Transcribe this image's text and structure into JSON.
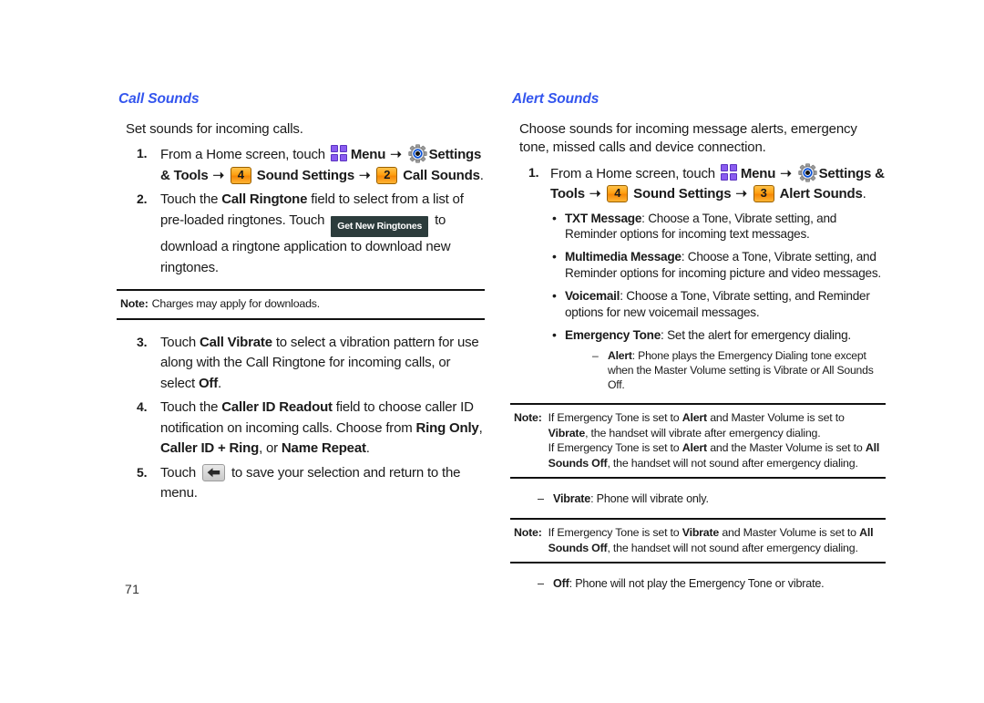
{
  "page": {
    "number": "71"
  },
  "left_column": {
    "heading": "Call Sounds",
    "intro": "Set sounds for incoming calls.",
    "steps": [
      {
        "num": "1.",
        "pre": "From a Home screen, touch",
        "menu_label": "Menu",
        "settings_label": "Settings &",
        "tools_label": "Tools",
        "badge1": "4",
        "badge1_label": "Sound Settings",
        "badge2": "2",
        "badge2_label": "Call Sounds",
        "period": "."
      },
      {
        "num": "2.",
        "t1": "Touch the ",
        "b1": "Call Ringtone",
        "t2": " field to select from a list of pre-loaded ringtones. Touch ",
        "button": "Get New Ringtones",
        "t3": " to download a ringtone application to download new ringtones."
      },
      {
        "num": "3.",
        "t1": "Touch ",
        "b1": "Call Vibrate",
        "t2": " to select a vibration pattern for use along with the Call Ringtone for incoming calls, or select ",
        "b2": "Off",
        "t3": "."
      },
      {
        "num": "4.",
        "t1": "Touch the ",
        "b1": "Caller ID Readout",
        "t2": " field to choose caller ID notification on incoming calls.  Choose from ",
        "b2": "Ring Only",
        "t3": ", ",
        "b3": "Caller ID + Ring",
        "t4": ", or ",
        "b4": "Name Repeat",
        "t5": "."
      },
      {
        "num": "5.",
        "t1": "Touch ",
        "t2": " to save your selection and return to the menu."
      }
    ],
    "note": {
      "label": "Note:",
      "text": "Charges may apply for downloads."
    }
  },
  "right_column": {
    "heading": "Alert Sounds",
    "intro": "Choose sounds for incoming message alerts, emergency tone, missed calls and device connection.",
    "step1": {
      "num": "1.",
      "pre": "From a Home screen, touch",
      "menu_label": "Menu",
      "settings_label": "Settings &",
      "tools_label": "Tools",
      "badge1": "4",
      "badge1_label": "Sound Settings",
      "badge2": "3",
      "badge2_label": "Alert Sounds",
      "period": "."
    },
    "bullets": [
      {
        "term": "TXT Message",
        "desc": ": Choose a Tone, Vibrate setting, and Reminder options for incoming text messages."
      },
      {
        "term": "Multimedia Message",
        "desc": ": Choose a Tone, Vibrate setting, and Reminder options for incoming picture and video messages."
      },
      {
        "term": "Voicemail",
        "desc": ": Choose a Tone, Vibrate setting, and Reminder options for new voicemail messages."
      },
      {
        "term": "Emergency Tone",
        "desc": ": Set the alert for emergency dialing."
      }
    ],
    "sub_alert": {
      "term": "Alert",
      "desc": ": Phone plays the Emergency Dialing tone except when the Master Volume setting is Vibrate or All Sounds Off."
    },
    "note1": {
      "label": "Note:",
      "p1_a": "If Emergency Tone is set to ",
      "p1_b1": "Alert",
      "p1_b": " and Master Volume is set to ",
      "p1_b2": "Vibrate",
      "p1_c": ", the handset will vibrate after emergency dialing.",
      "p2_a": "If Emergency Tone is set to ",
      "p2_b1": "Alert",
      "p2_b": " and the Master Volume is set to ",
      "p2_b2": "All Sounds Off",
      "p2_c": ", the handset will not sound after emergency dialing."
    },
    "sub_vibrate": {
      "term": "Vibrate",
      "desc": ": Phone will vibrate only."
    },
    "note2": {
      "label": "Note:",
      "p1_a": "If Emergency Tone is set to ",
      "p1_b1": "Vibrate",
      "p1_b": " and Master Volume is set to ",
      "p1_b2": "All Sounds Off",
      "p1_c": ", the handset will not sound after emergency dialing."
    },
    "sub_off": {
      "term": "Off",
      "desc": ": Phone will not play the Emergency Tone or vibrate."
    }
  },
  "icons": {
    "menu": "menu-grid-icon",
    "settings": "gear-icon",
    "back": "back-arrow-icon"
  },
  "colors": {
    "heading": "#3355ee",
    "badge": "#ffa011",
    "menu_tile": "#8A5CF0",
    "button": "#2c3c3c"
  }
}
